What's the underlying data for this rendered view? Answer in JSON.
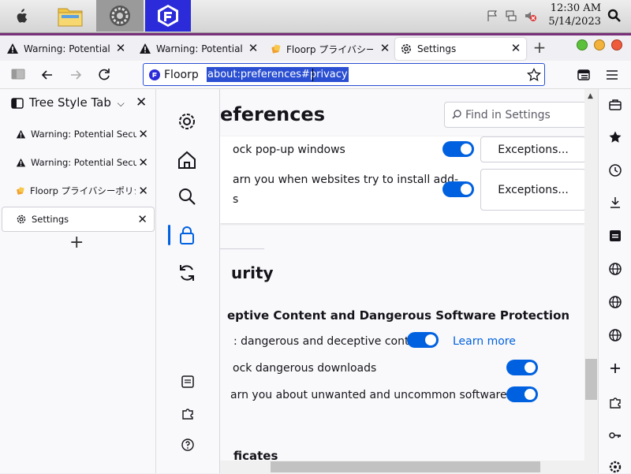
{
  "os": {
    "time": "12:30 AM",
    "date": "5/14/2023"
  },
  "tabs": [
    {
      "label": "Warning: Potential Se",
      "icon": "warning-icon"
    },
    {
      "label": "Warning: Potential Se",
      "icon": "warning-icon"
    },
    {
      "label": "Floorp プライバシー・ポ",
      "icon": "floorp-icon"
    },
    {
      "label": "Settings",
      "icon": "gear-icon"
    }
  ],
  "urlbar": {
    "identity_label": "Floorp",
    "url": "about:preferences#privacy"
  },
  "sidebar": {
    "title": "Tree Style Tab",
    "tabs": [
      {
        "label": "Warning: Potential Securit",
        "icon": "warning-icon"
      },
      {
        "label": "Warning: Potential Securit",
        "icon": "warning-icon"
      },
      {
        "label": "Floorp プライバシーポリシ",
        "icon": "floorp-icon"
      },
      {
        "label": "Settings",
        "icon": "gear-icon"
      }
    ]
  },
  "settings": {
    "page_title": "eferences",
    "search_placeholder": "Find in Settings",
    "popup_label": "ock pop-up windows",
    "addons_label_1": "arn you when websites try to install add-",
    "addons_label_2": "s",
    "exceptions_label": "Exceptions...",
    "security_heading": "urity",
    "deceptive_heading": "eptive Content and Dangerous Software Protection",
    "block_dangerous_content": ": dangerous and deceptive content",
    "learn_more": "Learn more",
    "block_downloads": "ock dangerous downloads",
    "warn_unwanted": "arn you about unwanted and uncommon software",
    "certificates_heading": "ficates"
  },
  "colors": {
    "accent": "#0061e0",
    "url_highlight": "#2a4fd2",
    "os_purple": "#7a2f7a"
  }
}
